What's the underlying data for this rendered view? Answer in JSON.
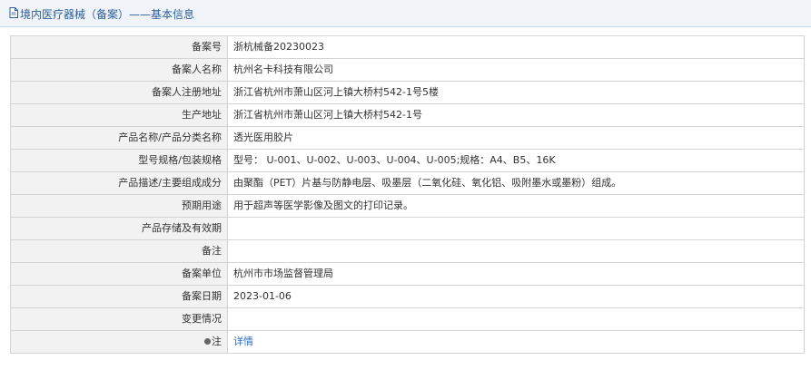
{
  "header": {
    "icon": "document-icon",
    "title": "境内医疗器械（备案）——基本信息"
  },
  "rows": [
    {
      "label": "备案号",
      "value": "浙杭械备20230023"
    },
    {
      "label": "备案人名称",
      "value": "杭州名卡科技有限公司"
    },
    {
      "label": "备案人注册地址",
      "value": "浙江省杭州市萧山区河上镇大桥村542-1号5楼"
    },
    {
      "label": "生产地址",
      "value": "浙江省杭州市萧山区河上镇大桥村542-1号"
    },
    {
      "label": "产品名称/产品分类名称",
      "value": "透光医用胶片"
    },
    {
      "label": "型号规格/包装规格",
      "value": "型号： U-001、U-002、U-003、U-004、U-005;规格：A4、B5、16K"
    },
    {
      "label": "产品描述/主要组成成分",
      "value": "由聚酯（PET）片基与防静电层、吸墨层（二氧化硅、氧化铝、吸附墨水或墨粉）组成。"
    },
    {
      "label": "预期用途",
      "value": "用于超声等医学影像及图文的打印记录。"
    },
    {
      "label": "产品存储及有效期",
      "value": ""
    },
    {
      "label": "备注",
      "value": ""
    },
    {
      "label": "备案单位",
      "value": "杭州市市场监督管理局"
    },
    {
      "label": "备案日期",
      "value": "2023-01-06"
    },
    {
      "label": "变更情况",
      "value": ""
    }
  ],
  "note_row": {
    "icon": "pin-icon",
    "label": "注",
    "link_text": "详情"
  },
  "colors": {
    "header_bg": "#f0f4f9",
    "header_text": "#2b5e9b",
    "label_bg": "#f2f2f2",
    "border": "#d4d4d4",
    "link": "#2b6cc4"
  }
}
